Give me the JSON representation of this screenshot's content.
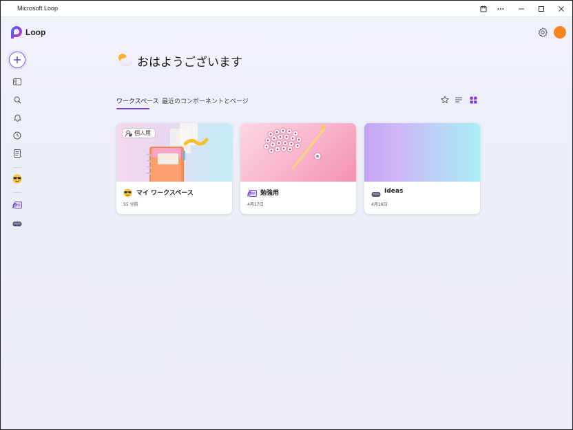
{
  "window": {
    "title": "Microsoft Loop"
  },
  "app": {
    "name": "Loop"
  },
  "greeting": "おはようございます",
  "tabs": [
    {
      "label": "ワークスペース",
      "active": true
    },
    {
      "label": "最近のコンポーネントとページ",
      "active": false
    }
  ],
  "workspaces": [
    {
      "title": "マイ ワークスペース",
      "date": "55 分前",
      "badge": "個人用"
    },
    {
      "title": "勉強用",
      "date": "4月17日"
    },
    {
      "title": "Ideas",
      "date": "4月16日"
    }
  ],
  "colors": {
    "accent": "#7a3ee0",
    "avatar": "#f7841f"
  }
}
